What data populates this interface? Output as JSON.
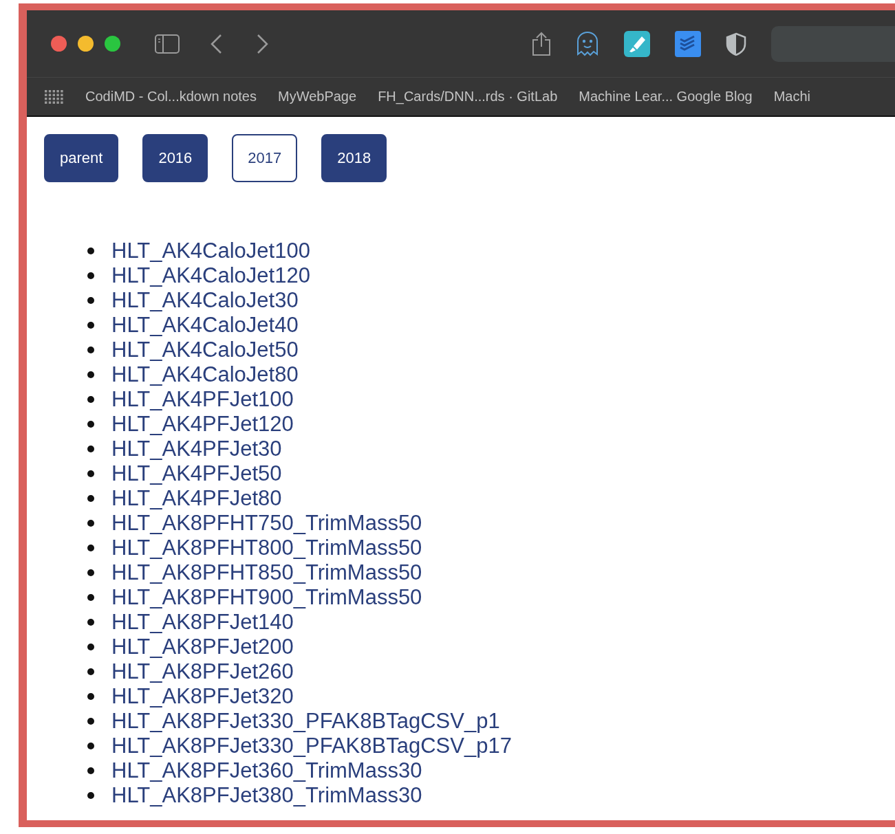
{
  "bookmarks": [
    "CodiMD - Col...kdown notes",
    "MyWebPage",
    "FH_Cards/DNN...rds · GitLab",
    "Machine Lear... Google Blog",
    "Machi"
  ],
  "nav_buttons": [
    {
      "label": "parent",
      "selected": false
    },
    {
      "label": "2016",
      "selected": false
    },
    {
      "label": "2017",
      "selected": true
    },
    {
      "label": "2018",
      "selected": false
    }
  ],
  "links": [
    "HLT_AK4CaloJet100",
    "HLT_AK4CaloJet120",
    "HLT_AK4CaloJet30",
    "HLT_AK4CaloJet40",
    "HLT_AK4CaloJet50",
    "HLT_AK4CaloJet80",
    "HLT_AK4PFJet100",
    "HLT_AK4PFJet120",
    "HLT_AK4PFJet30",
    "HLT_AK4PFJet50",
    "HLT_AK4PFJet80",
    "HLT_AK8PFHT750_TrimMass50",
    "HLT_AK8PFHT800_TrimMass50",
    "HLT_AK8PFHT850_TrimMass50",
    "HLT_AK8PFHT900_TrimMass50",
    "HLT_AK8PFJet140",
    "HLT_AK8PFJet200",
    "HLT_AK8PFJet260",
    "HLT_AK8PFJet320",
    "HLT_AK8PFJet330_PFAK8BTagCSV_p1",
    "HLT_AK8PFJet330_PFAK8BTagCSV_p17",
    "HLT_AK8PFJet360_TrimMass30",
    "HLT_AK8PFJet380_TrimMass30"
  ]
}
